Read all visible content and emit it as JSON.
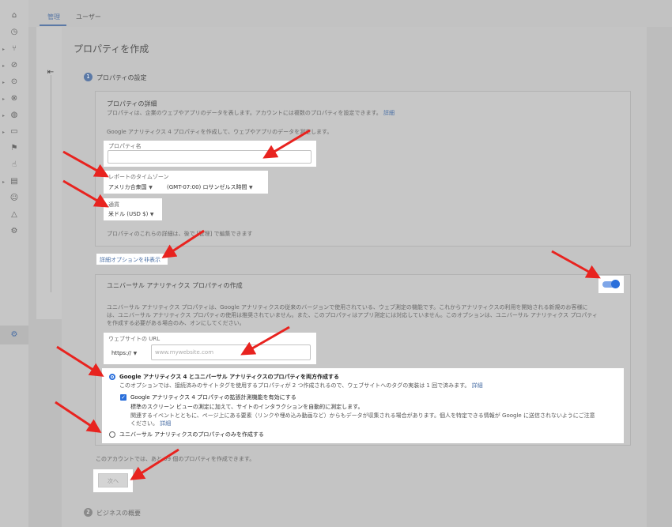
{
  "tabs": [
    "管理",
    "ユーザー"
  ],
  "page_title": "プロパティを作成",
  "step1": {
    "number": "1",
    "label": "プロパティの設定"
  },
  "details": {
    "heading": "プロパティの詳細",
    "desc": "プロパティは、企業のウェブやアプリのデータを表します。アカウントには複数のプロパティを設定できます。",
    "desc_link": "詳細",
    "intro": "Google アナリティクス 4 プロパティを作成して、ウェブやアプリのデータを測定します。"
  },
  "property_name": {
    "label": "プロパティ名",
    "value": ""
  },
  "timezone": {
    "label": "レポートのタイムゾーン",
    "country": "アメリカ合衆国",
    "zone": "(GMT-07:00) ロサンゼルス時間"
  },
  "currency": {
    "label": "通貨",
    "value": "米ドル (USD $)"
  },
  "edit_note": "プロパティのこれらの詳細は、後で [管理] で編集できます",
  "advanced_link": "詳細オプションを非表示",
  "ua": {
    "heading": "ユニバーサル アナリティクス プロパティの作成",
    "desc_line1": "ユニバーサル アナリティクス プロパティは、Google アナリティクスの従来のバージョンで使用されている、ウェブ測定の機能です。これからアナリティクスの利用を開始される新規のお客様に",
    "desc_line2": "は、ユニバーサル アナリティクス プロパティの使用は推奨されていません。また、このプロパティはアプリ測定には対応していません。このオプションは、ユニバーサル アナリティクス プロパティ",
    "desc_line3": "を作成する必要がある場合のみ、オンにしてください。",
    "toggle_on": true
  },
  "website": {
    "label": "ウェブサイトの URL",
    "protocol": "https://",
    "placeholder": "www.mywebsite.com"
  },
  "option_both": {
    "label": "Google アナリティクス 4 とユニバーサル アナリティクスのプロパティを両方作成する",
    "desc": "このオプションでは、接続済みのサイトタグを使用するプロパティが 2 つ作成されるので、ウェブサイトへのタグの実装は 1 回で済みます。",
    "desc_link": "詳細"
  },
  "enhanced": {
    "label": "Google アナリティクス 4 プロパティの拡張計測機能を有効にする",
    "line1": "標準のスクリーン ビューの測定に加えて、サイトのインタラクションを自動的に測定します。",
    "line2": "関連するイベントとともに、ページ上にある要素（リンクや埋め込み動画など）からもデータが収集される場合があります。個人を特定できる情報が Google に送信されないようにご注意",
    "line3": "ください。",
    "link": "詳細"
  },
  "option_ua_only": {
    "label": "ユニバーサル アナリティクスのプロパティのみを作成する"
  },
  "account_note": "このアカウントでは、あと 99 個のプロパティを作成できます。",
  "next_button": "次へ",
  "step2": {
    "number": "2",
    "label": "ビジネスの概要"
  },
  "colors": {
    "annotation_arrow": "#e8231f",
    "accent": "#2a6fdb",
    "link": "#4a6fa5"
  }
}
